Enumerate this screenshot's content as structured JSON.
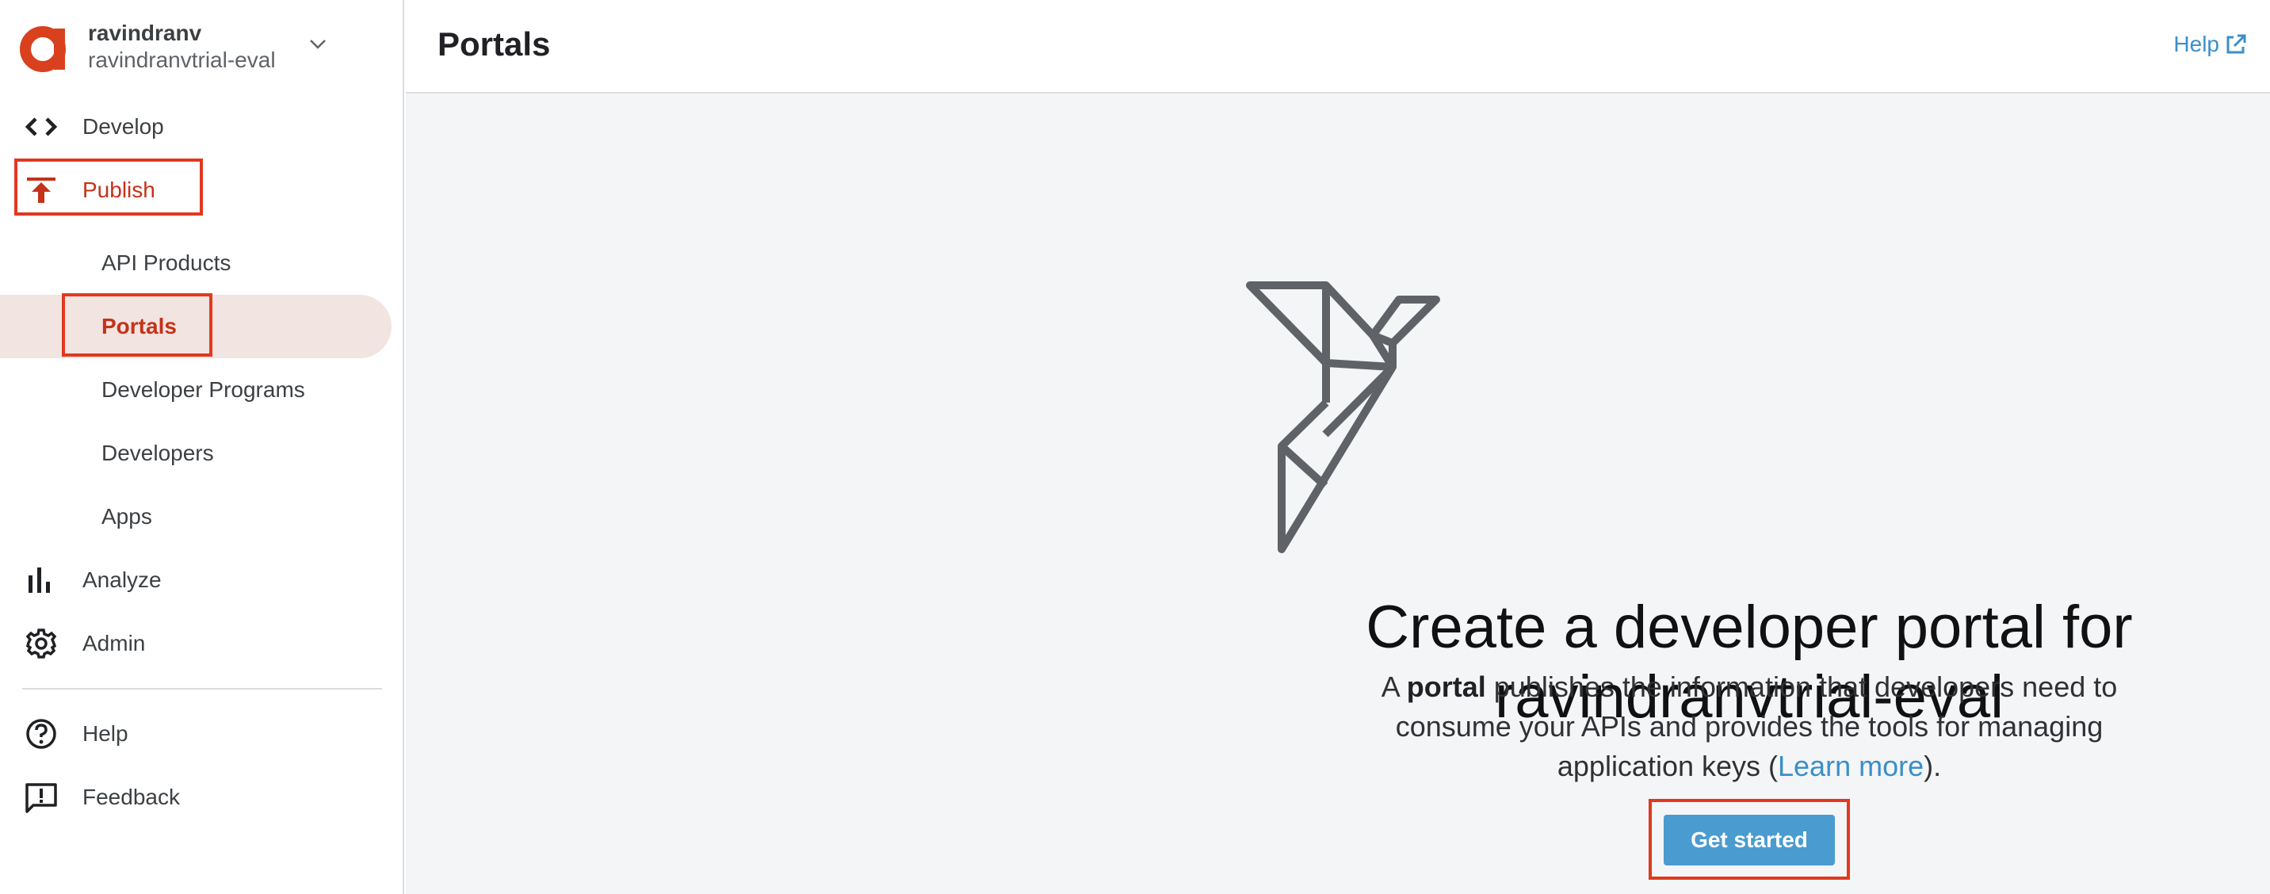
{
  "org": {
    "user": "ravindranv",
    "name": "ravindranvtrial-eval"
  },
  "nav": {
    "develop": "Develop",
    "publish": "Publish",
    "publish_items": [
      "API Products",
      "Portals",
      "Developer Programs",
      "Developers",
      "Apps"
    ],
    "analyze": "Analyze",
    "admin": "Admin",
    "help": "Help",
    "feedback": "Feedback"
  },
  "header": {
    "title": "Portals",
    "help_link": "Help"
  },
  "main": {
    "hero_line1": "Create a developer portal for",
    "hero_line2": "ravindranvtrial-eval",
    "desc_prefix": "A ",
    "desc_bold": "portal",
    "desc_line1_rest": " publishes the information that developers need to",
    "desc_line2": "consume your APIs and provides the tools for managing",
    "desc_line3_start": "application keys (",
    "desc_link": "Learn more",
    "desc_line3_end": ").",
    "cta": "Get started"
  },
  "colors": {
    "accent": "#c5311a",
    "highlight": "#e0391f",
    "link": "#3a8fc9",
    "button": "#4a9bd0",
    "active_bg": "#f2e4e0"
  },
  "icons": {
    "logo": "apigee-logo-icon",
    "develop": "code-brackets-icon",
    "publish": "publish-upload-icon",
    "analyze": "bar-chart-icon",
    "admin": "gear-icon",
    "help": "question-circle-icon",
    "feedback": "feedback-icon",
    "external": "external-link-icon",
    "illustration": "origami-bird-icon"
  }
}
